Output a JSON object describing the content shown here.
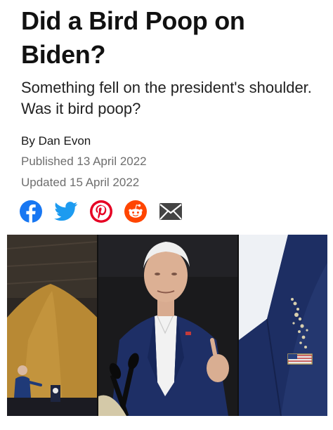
{
  "article": {
    "title": "Did a Bird Poop on Biden?",
    "subtitle": "Something fell on the president's shoulder. Was it bird poop?",
    "byline_prefix": "By",
    "author": "Dan Evon",
    "published": "Published 13 April 2022",
    "updated": "Updated 15 April 2022"
  },
  "share": {
    "icons": [
      "facebook-icon",
      "twitter-icon",
      "pinterest-icon",
      "reddit-icon",
      "email-icon"
    ],
    "colors": {
      "facebook": "#1877f2",
      "twitter": "#1d9bf0",
      "pinterest": "#e60023",
      "reddit": "#ff4500",
      "email": "#444444"
    }
  },
  "photos": {
    "panels": [
      "grain-pile-photo",
      "speaking-at-podium-photo",
      "lapel-pin-closeup-photo"
    ]
  }
}
